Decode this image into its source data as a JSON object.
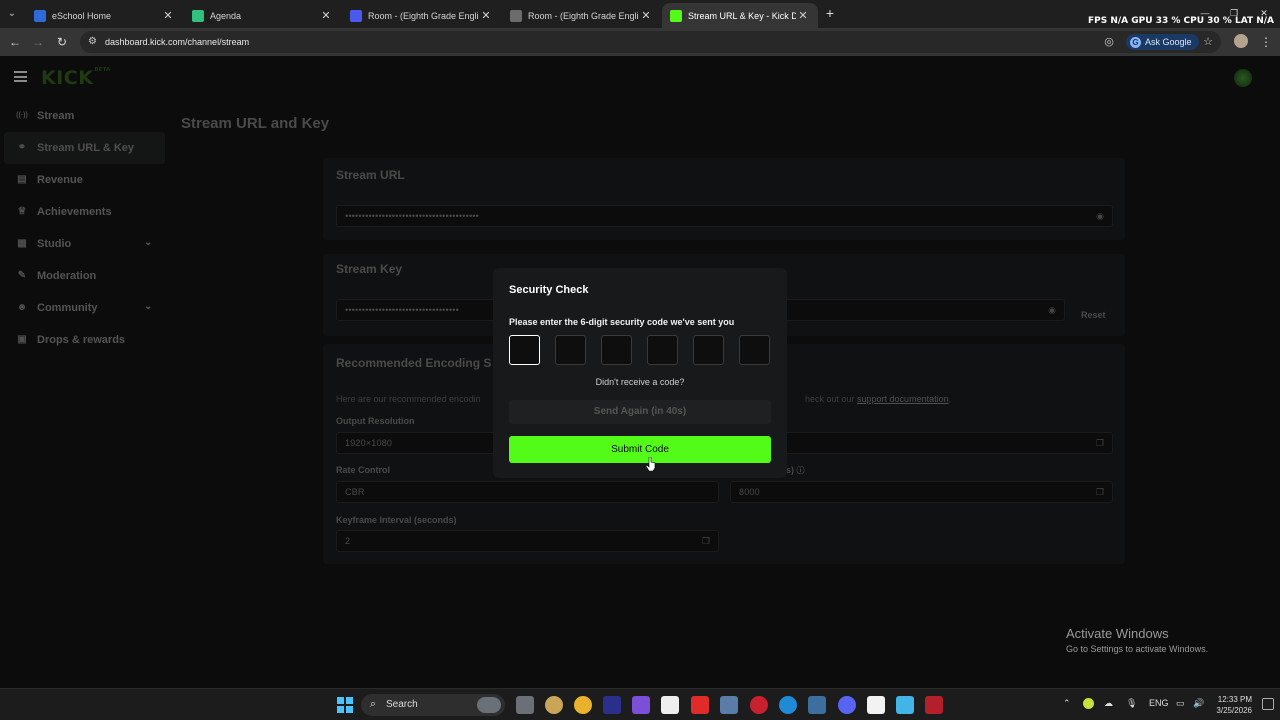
{
  "browser": {
    "tabs": [
      {
        "title": "eSchool Home",
        "favicon_color": "#2f6ad8"
      },
      {
        "title": "Agenda",
        "favicon_color": "#2ec27e"
      },
      {
        "title": "Room - (Eighth Grade English A",
        "favicon_color": "#4a5af0"
      },
      {
        "title": "Room - (Eighth Grade English A",
        "favicon_color": "#4a5af0"
      },
      {
        "title": "Stream URL & Key - Kick Dashb",
        "favicon_color": "#53fc18"
      }
    ],
    "stats": "FPS  N/A  GPU  33 %  CPU  30 %  LAT  N/A",
    "url": "dashboard.kick.com/channel/stream",
    "ask_google": "Ask Google"
  },
  "app": {
    "logo": "KICK",
    "logo_sup": "BETA",
    "sidebar": {
      "items": [
        {
          "label": "Stream",
          "icon": "broadcast-icon",
          "glyph": "((·))"
        },
        {
          "label": "Stream URL & Key",
          "icon": "link-icon",
          "glyph": "⚭"
        },
        {
          "label": "Revenue",
          "icon": "chart-icon",
          "glyph": "▤"
        },
        {
          "label": "Achievements",
          "icon": "trophy-icon",
          "glyph": "♕"
        },
        {
          "label": "Studio",
          "icon": "studio-icon",
          "glyph": "▦"
        },
        {
          "label": "Moderation",
          "icon": "wrench-icon",
          "glyph": "✎"
        },
        {
          "label": "Community",
          "icon": "people-icon",
          "glyph": "☻"
        },
        {
          "label": "Drops & rewards",
          "icon": "gift-icon",
          "glyph": "▣"
        }
      ]
    },
    "page_title": "Stream URL and Key",
    "stream_url": {
      "title": "Stream URL",
      "value": "••••••••••••••••••••••••••••••••••••••••"
    },
    "stream_key": {
      "title": "Stream Key",
      "value": "••••••••••••••••••••••••••••••••••",
      "reset": "Reset"
    },
    "encoding": {
      "title": "Recommended Encoding S",
      "desc_left": "Here are our recommended encodin",
      "desc_right": "heck out our ",
      "link": "support documentation",
      "desc_end": ".",
      "output_resolution_label": "Output Resolution",
      "output_resolution": "1920×1080",
      "rate_control_label": "Rate Control",
      "rate_control": "CBR",
      "bitrate_label_tail": "s)",
      "bitrate": "8000",
      "keyframe_label": "Keyframe Interval (seconds)",
      "keyframe": "2"
    },
    "modal": {
      "title": "Security Check",
      "prompt": "Please enter the 6-digit security code we've sent you",
      "question": "Didn't receive a code?",
      "send_again": "Send Again (in 40s)",
      "submit": "Submit Code"
    }
  },
  "windows": {
    "activate_title": "Activate Windows",
    "activate_sub": "Go to Settings to activate Windows.",
    "search": "Search",
    "lang": "ENG",
    "time": "12:33 PM",
    "date": "3/25/2026"
  },
  "colors": {
    "accent": "#53fc18",
    "modal_bg": "#18191a"
  }
}
